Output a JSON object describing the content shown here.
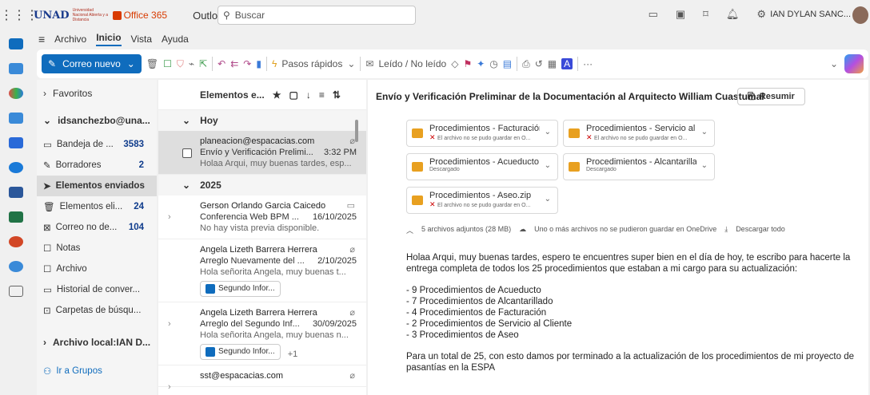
{
  "header": {
    "unad": "UNAD",
    "unad_sub": "Universidad Nacional Abierta y a Distancia",
    "office": "Office 365",
    "app": "Outlook",
    "search_placeholder": "Buscar",
    "user": "IAN DYLAN SANC..."
  },
  "menu": [
    "Archivo",
    "Inicio",
    "Vista",
    "Ayuda"
  ],
  "ribbon": {
    "new_mail": "Correo nuevo",
    "quick_steps": "Pasos rápidos",
    "read_unread": "Leído / No leído",
    "more": "···"
  },
  "folders": {
    "favoritos": "Favoritos",
    "account": "idsanchezbo@una...",
    "items": [
      {
        "label": "Bandeja de ...",
        "count": "3583"
      },
      {
        "label": "Borradores",
        "count": "2"
      },
      {
        "label": "Elementos enviados",
        "count": ""
      },
      {
        "label": "Elementos eli...",
        "count": "24"
      },
      {
        "label": "Correo no de...",
        "count": "104"
      },
      {
        "label": "Notas",
        "count": ""
      },
      {
        "label": "Archivo",
        "count": ""
      },
      {
        "label": "Historial de conver...",
        "count": ""
      },
      {
        "label": "Carpetas de búsqu...",
        "count": ""
      }
    ],
    "local_archive": "Archivo local:IAN D...",
    "groups": "Ir a Grupos"
  },
  "message_list": {
    "title": "Elementos e...",
    "group_today": "Hoy",
    "group_2025": "2025",
    "messages": [
      {
        "from": "planeacion@espacacias.com",
        "subject": "Envío y Verificación Prelimi...",
        "date": "3:32 PM",
        "preview": "Holaa Arqui, muy buenas tardes, esp..."
      },
      {
        "from": "Gerson Orlando Garcia Caicedo",
        "subject": "Conferencia Web BPM ...",
        "date": "16/10/2025",
        "preview": "No hay vista previa disponible."
      },
      {
        "from": "Angela Lizeth Barrera Herrera",
        "subject": "Arreglo Nuevamente del ...",
        "date": "2/10/2025",
        "preview": "Hola señorita Angela, muy buenas t...",
        "attachment": "Segundo Infor..."
      },
      {
        "from": "Angela Lizeth Barrera Herrera",
        "subject": "Arreglo del Segundo Inf...",
        "date": "30/09/2025",
        "preview": "Hola señorita Angela, muy buenas n...",
        "attachment": "Segundo Infor...",
        "extra": "+1"
      },
      {
        "from": "sst@espacacias.com",
        "subject": "",
        "date": "",
        "preview": ""
      }
    ]
  },
  "reading": {
    "subject": "Envío y Verificación Preliminar de la Documentación al Arquitecto William Cuastumal",
    "summarize": "Resumir",
    "attachments": [
      {
        "name": "Procedimientos - Facturación...",
        "status": "El archivo no se pudo guardar en O...",
        "error": true
      },
      {
        "name": "Procedimientos - Servicio al ...",
        "status": "El archivo no se pudo guardar en O...",
        "error": true
      },
      {
        "name": "Procedimientos - Acueducto....",
        "status": "Descargado",
        "error": false
      },
      {
        "name": "Procedimientos - Alcantarilla...",
        "status": "Descargado",
        "error": false
      },
      {
        "name": "Procedimientos - Aseo.zip",
        "status": "El archivo no se pudo guardar en O...",
        "error": true
      }
    ],
    "att_summary": "5 archivos adjuntos (28 MB)",
    "att_warning": "Uno o más archivos no se pudieron guardar en OneDrive",
    "download_all": "Descargar todo",
    "body_intro": "Holaa Arqui, muy buenas tardes, espero te encuentres super bien en el día de hoy, te escribo para hacerte la entrega completa de todos los 25 procedimientos que estaban a mi cargo para su actualización:",
    "body_list": [
      "- 9 Procedimientos de Acueducto",
      "- 7 Procedimientos de Alcantarillado",
      "- 4 Procedimientos de Facturación",
      "- 2 Procedimientos de Servicio al Cliente",
      "- 3 Procedimientos de Aseo"
    ],
    "body_outro": "Para un total de 25, con esto damos por terminado a la actualización de los procedimientos de mi proyecto de pasantías en la ESPA"
  }
}
